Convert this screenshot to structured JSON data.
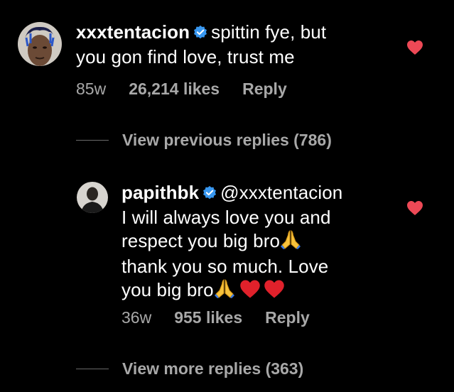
{
  "comment1": {
    "username": "xxxtentacion",
    "text_line1": "spittin fye, but",
    "text_line2": "you gon find love, trust me",
    "age": "85w",
    "likes": "26,214 likes",
    "reply_label": "Reply"
  },
  "view_previous": {
    "label": "View previous replies (786)"
  },
  "comment2": {
    "username": "papithbk",
    "mention": "@xxxtentacion",
    "text_line1": "I will always love you and",
    "text_line2": "respect you big bro",
    "text_line3": "thank you so much. Love",
    "text_line4": "you big bro",
    "age": "36w",
    "likes": "955 likes",
    "reply_label": "Reply"
  },
  "view_more": {
    "label": "View more replies (363)"
  },
  "colors": {
    "background": "#000000",
    "text": "#ffffff",
    "meta": "#a8a8a8",
    "verified": "#3897f0",
    "heart": "#ed4956"
  },
  "icons": [
    "verified-badge-icon",
    "heart-icon",
    "praying-hands-emoji",
    "red-heart-emoji"
  ]
}
